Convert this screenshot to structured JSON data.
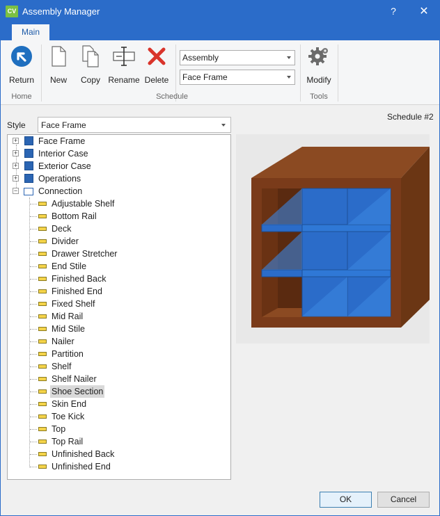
{
  "window": {
    "app_icon_text": "CV",
    "title": "Assembly Manager",
    "help": "?",
    "close": "✕"
  },
  "ribbon": {
    "tab": "Main",
    "buttons": {
      "return": "Return",
      "new": "New",
      "copy": "Copy",
      "rename": "Rename",
      "delete": "Delete",
      "modify": "Modify"
    },
    "combos": {
      "assembly": "Assembly",
      "face_frame": "Face Frame"
    },
    "groups": {
      "home": "Home",
      "schedule": "Schedule",
      "tools": "Tools"
    },
    "colors": {
      "accent": "#2b6cc9",
      "return_icon": "#1f6fbf",
      "delete_icon": "#d9342b"
    }
  },
  "main": {
    "schedule_label": "Schedule #2",
    "style_label": "Style",
    "style_value": "Face Frame",
    "tree": {
      "top_nodes": [
        "Face Frame",
        "Interior Case",
        "Exterior Case",
        "Operations",
        "Connection"
      ],
      "connection_children": [
        "Adjustable Shelf",
        "Bottom Rail",
        "Deck",
        "Divider",
        "Drawer Stretcher",
        "End Stile",
        "Finished Back",
        "Finished End",
        "Fixed Shelf",
        "Mid Rail",
        "Mid Stile",
        "Nailer",
        "Partition",
        "Shelf",
        "Shelf Nailer",
        "Shoe Section",
        "Skin End",
        "Toe Kick",
        "Top",
        "Top Rail",
        "Unfinished Back",
        "Unfinished End"
      ],
      "selected": "Shoe Section"
    },
    "preview": {
      "cabinet_color": "#7a3b1a",
      "highlight_color": "#2b6cc9"
    }
  },
  "footer": {
    "ok": "OK",
    "cancel": "Cancel"
  }
}
